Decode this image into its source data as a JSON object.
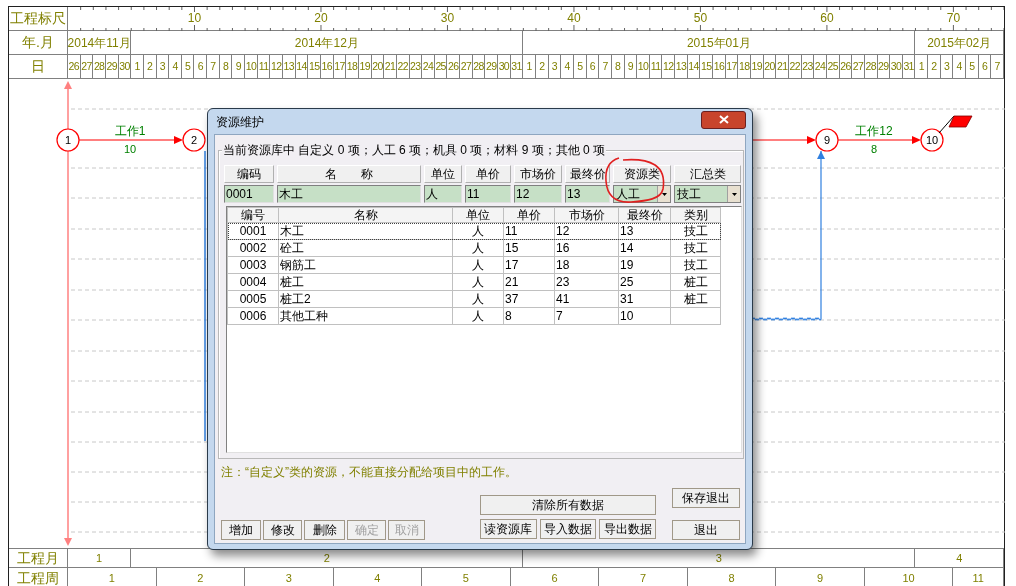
{
  "ruler": {
    "label": "工程标尺",
    "ticks": [
      "10",
      "20",
      "30",
      "40",
      "50",
      "60",
      "70"
    ]
  },
  "months_row": {
    "label": "年.月",
    "days_label": "日",
    "months": [
      {
        "text": "2014年11月",
        "days": [
          "26",
          "27",
          "28",
          "29",
          "30"
        ]
      },
      {
        "text": "2014年12月",
        "days": [
          "1",
          "2",
          "3",
          "4",
          "5",
          "6",
          "7",
          "8",
          "9",
          "10",
          "11",
          "12",
          "13",
          "14",
          "15",
          "16",
          "17",
          "18",
          "19",
          "20",
          "21",
          "22",
          "23",
          "24",
          "25",
          "26",
          "27",
          "28",
          "29",
          "30",
          "31"
        ]
      },
      {
        "text": "2015年01月",
        "days": [
          "1",
          "2",
          "3",
          "4",
          "5",
          "6",
          "7",
          "8",
          "9",
          "10",
          "11",
          "12",
          "13",
          "14",
          "15",
          "16",
          "17",
          "18",
          "19",
          "20",
          "21",
          "22",
          "23",
          "24",
          "25",
          "26",
          "27",
          "28",
          "29",
          "30",
          "31"
        ]
      },
      {
        "text": "2015年02月",
        "days": [
          "1",
          "2",
          "3",
          "4",
          "5",
          "6",
          "7"
        ]
      }
    ]
  },
  "network": {
    "nodes": [
      "1",
      "2",
      "9",
      "10"
    ],
    "activities": [
      {
        "name": "工作1",
        "duration": "10"
      },
      {
        "name": "工作12",
        "duration": "8"
      }
    ]
  },
  "dialog": {
    "title": "资源维护",
    "summary": "当前资源库中 自定义 0 项；人工 6 项；机具 0 项；材料 9 项；其他 0 项",
    "fields": [
      {
        "label": "编码",
        "value": "0001",
        "kind": "text"
      },
      {
        "label": "名　　称",
        "value": "木工",
        "kind": "text"
      },
      {
        "label": "单位",
        "value": "人",
        "kind": "text"
      },
      {
        "label": "单价",
        "value": "11",
        "kind": "text"
      },
      {
        "label": "市场价",
        "value": "12",
        "kind": "text"
      },
      {
        "label": "最终价",
        "value": "13",
        "kind": "text"
      },
      {
        "label": "资源类",
        "value": "人工",
        "kind": "select"
      },
      {
        "label": "汇总类",
        "value": "技工",
        "kind": "select"
      }
    ],
    "table": {
      "columns": [
        "编号",
        "名称",
        "单位",
        "单价",
        "市场价",
        "最终价",
        "类别"
      ],
      "rows": [
        {
          "cells": [
            "0001",
            "木工",
            "人",
            "11",
            "12",
            "13",
            "技工"
          ],
          "selected": true
        },
        {
          "cells": [
            "0002",
            "砼工",
            "人",
            "15",
            "16",
            "14",
            "技工"
          ],
          "selected": false
        },
        {
          "cells": [
            "0003",
            "钢筋工",
            "人",
            "17",
            "18",
            "19",
            "技工"
          ],
          "selected": false
        },
        {
          "cells": [
            "0004",
            "桩工",
            "人",
            "21",
            "23",
            "25",
            "桩工"
          ],
          "selected": false
        },
        {
          "cells": [
            "0005",
            "桩工2",
            "人",
            "37",
            "41",
            "31",
            "桩工"
          ],
          "selected": false
        },
        {
          "cells": [
            "0006",
            "其他工种",
            "人",
            "8",
            "7",
            "10"
          ],
          "selected": false
        }
      ]
    },
    "note": "注：“自定义”类的资源，不能直接分配给项目中的工作。",
    "edit_buttons": [
      {
        "label": "增加",
        "disabled": false
      },
      {
        "label": "修改",
        "disabled": false
      },
      {
        "label": "删除",
        "disabled": false
      },
      {
        "label": "确定",
        "disabled": true
      },
      {
        "label": "取消",
        "disabled": true
      }
    ],
    "data_buttons": {
      "clear": "清除所有数据",
      "others": [
        "读资源库",
        "导入数据",
        "导出数据"
      ]
    },
    "exit_buttons": [
      "保存退出",
      "退出"
    ]
  },
  "project_months": {
    "label": "工程月",
    "cells": [
      "1",
      "2",
      "3",
      "4"
    ]
  },
  "project_weeks": {
    "label": "工程周",
    "cells": [
      "1",
      "2",
      "3",
      "4",
      "5",
      "6",
      "7",
      "8",
      "9",
      "10",
      "11"
    ]
  }
}
